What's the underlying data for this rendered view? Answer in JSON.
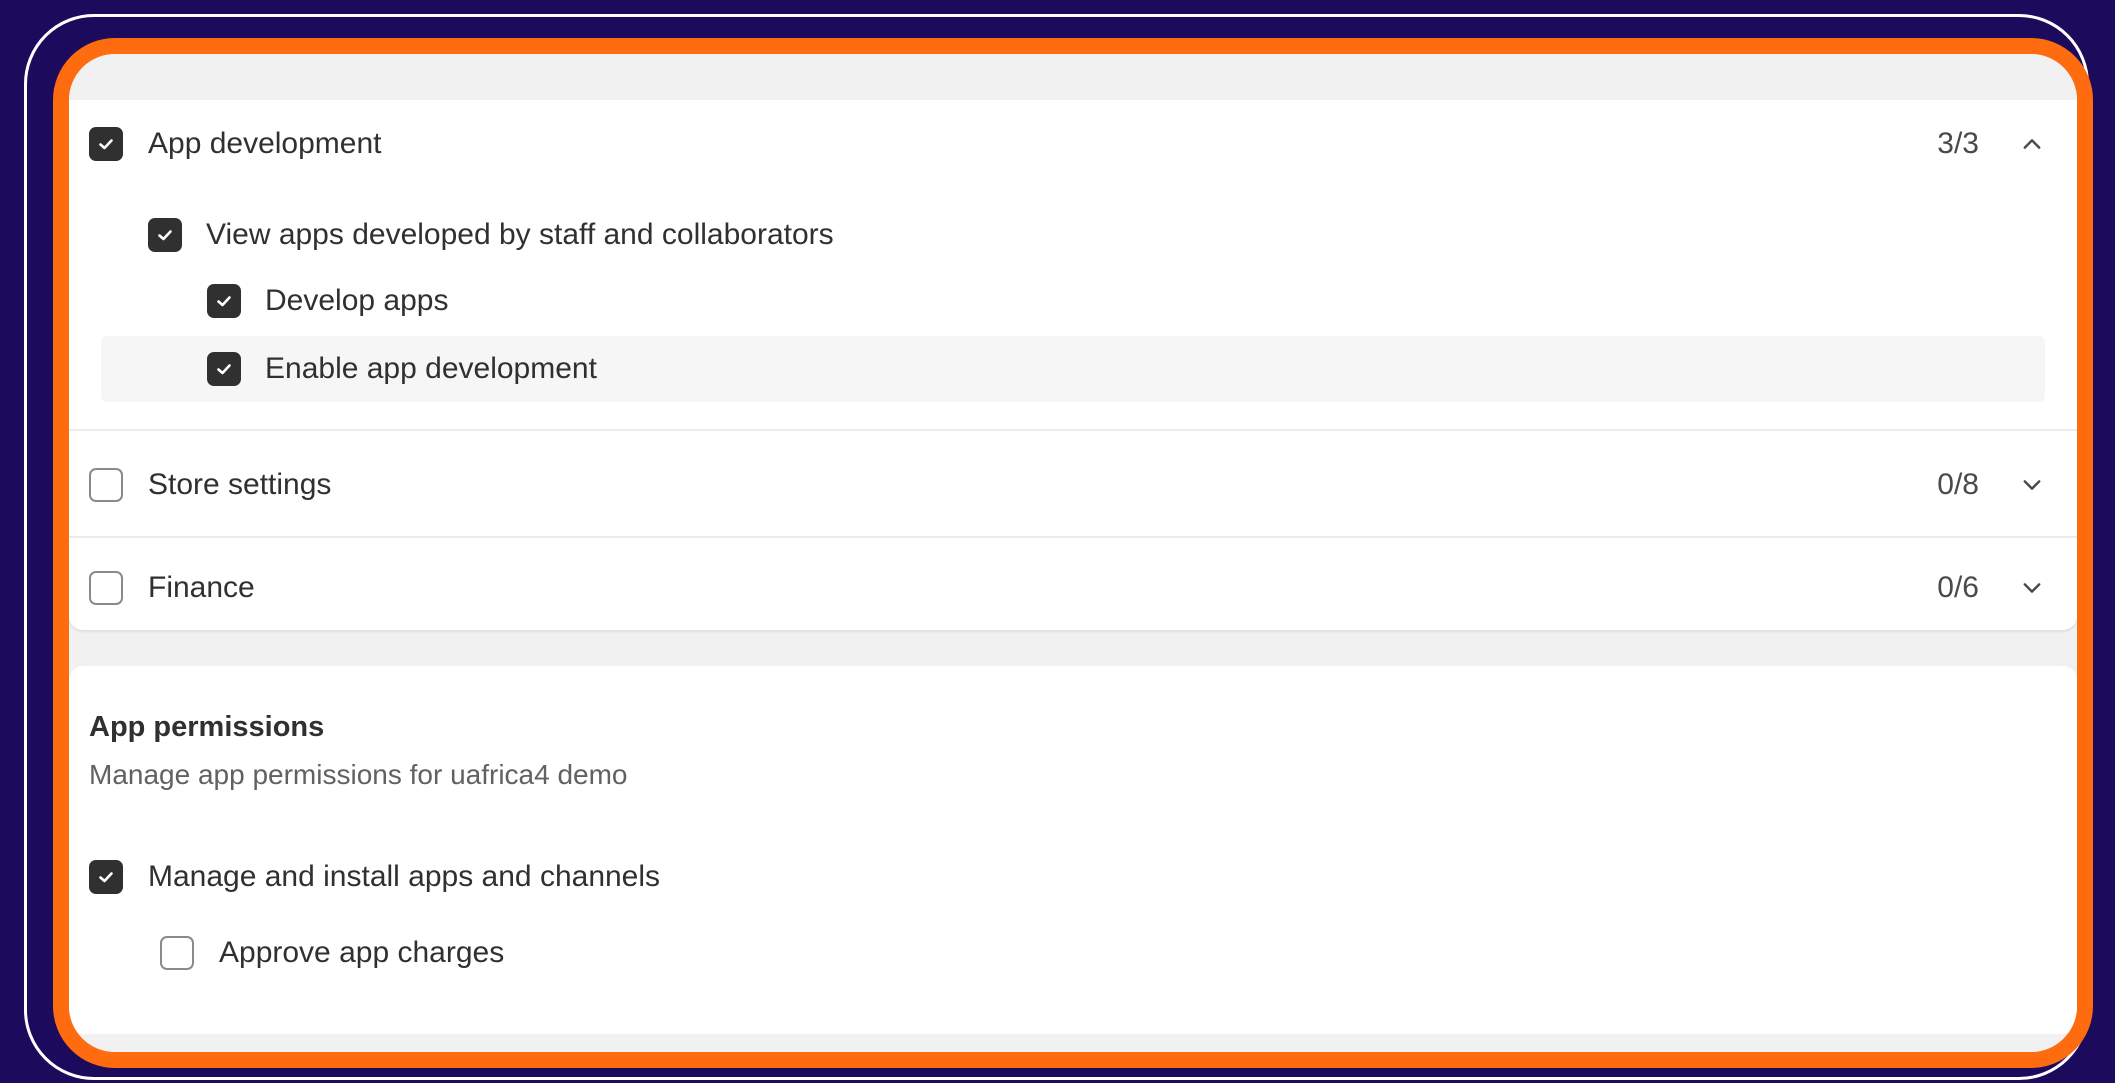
{
  "permission_groups": [
    {
      "label": "App development",
      "count": "3/3",
      "checked": true,
      "expanded": true,
      "children": [
        {
          "label": "View apps developed by staff and collaborators",
          "checked": true
        },
        {
          "label": "Develop apps",
          "checked": true
        },
        {
          "label": "Enable app development",
          "checked": true
        }
      ]
    },
    {
      "label": "Store settings",
      "count": "0/8",
      "checked": false,
      "expanded": false
    },
    {
      "label": "Finance",
      "count": "0/6",
      "checked": false,
      "expanded": false
    }
  ],
  "app_permissions": {
    "title": "App permissions",
    "subtitle": "Manage app permissions for uafrica4 demo",
    "items": [
      {
        "label": "Manage and install apps and channels",
        "checked": true
      },
      {
        "label": "Approve app charges",
        "checked": false
      }
    ]
  },
  "icons": {
    "check": "checkmark-icon",
    "expanded": "chevron-up-icon",
    "collapsed": "chevron-down-icon"
  },
  "colors": {
    "background": "#1c0b5c",
    "frame_accent": "#ff6b0f",
    "checkbox_checked": "#303030"
  }
}
